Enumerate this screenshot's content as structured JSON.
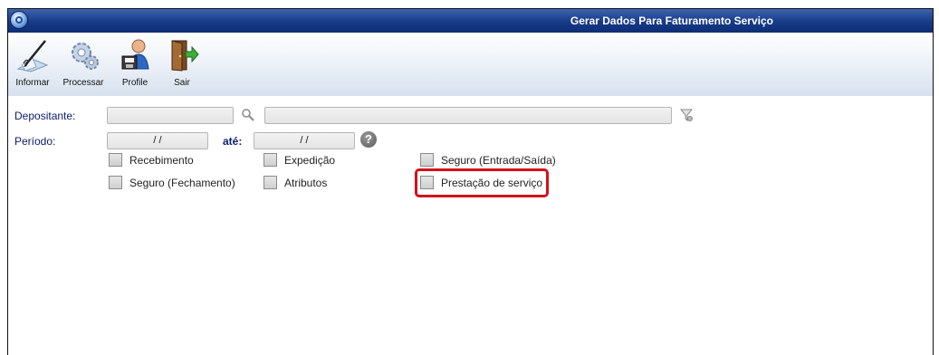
{
  "window": {
    "title": "Gerar Dados Para Faturamento Serviço"
  },
  "toolbar": {
    "items": [
      {
        "label": "Informar",
        "icon": "pencil-note-icon"
      },
      {
        "label": "Processar",
        "icon": "gears-icon"
      },
      {
        "label": "Profile",
        "icon": "user-profile-icon"
      },
      {
        "label": "Sair",
        "icon": "exit-door-icon"
      }
    ]
  },
  "form": {
    "depositante_label": "Depositante:",
    "depositante_code": "",
    "depositante_name": "",
    "periodo_label": "Período:",
    "periodo_start": "/ /",
    "ate_label": "até:",
    "periodo_end": "/ /",
    "checkboxes": [
      {
        "label": "Recebimento",
        "checked": false
      },
      {
        "label": "Expedição",
        "checked": false
      },
      {
        "label": "Seguro (Entrada/Saída)",
        "checked": false
      },
      {
        "label": "Seguro (Fechamento)",
        "checked": false
      },
      {
        "label": "Atributos",
        "checked": false
      },
      {
        "label": "Prestação de serviço",
        "checked": false
      }
    ]
  },
  "colors": {
    "title_bar": "#173a87",
    "label": "#0b1d6b",
    "highlight": "#d4101b"
  }
}
